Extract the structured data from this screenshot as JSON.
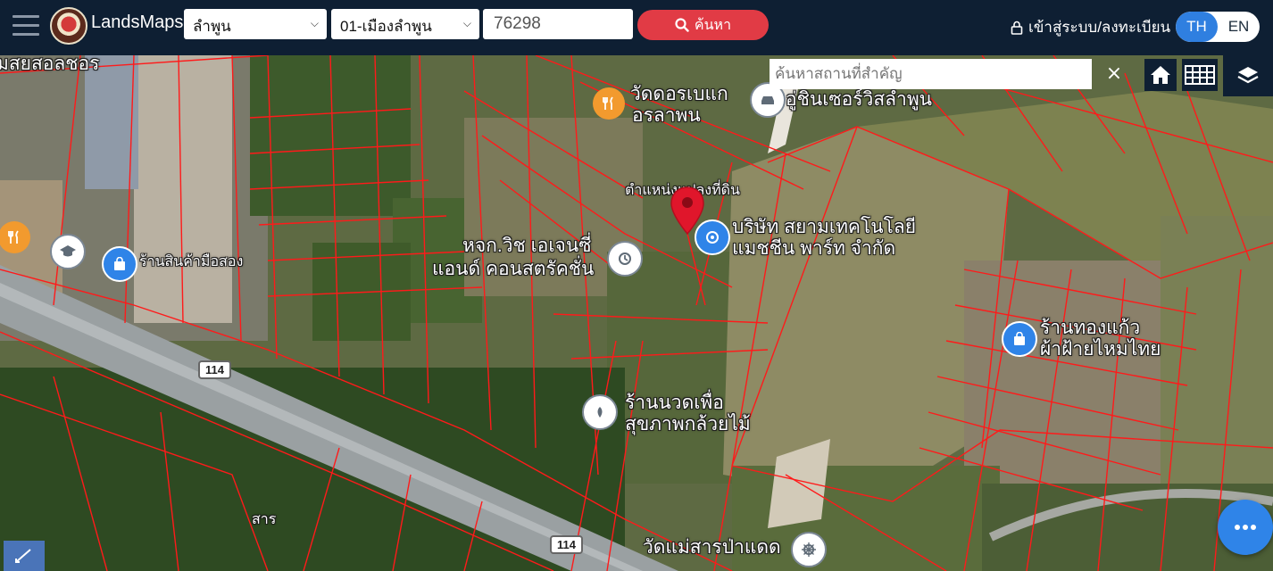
{
  "header": {
    "brand": "LandsMaps",
    "province_select": "ลำพูน",
    "district_select": "01-เมืองลำพูน",
    "parcel_number": "76298",
    "search_button": "ค้นหา",
    "login_label": "เข้าสู่ระบบ/ลงทะเบียน",
    "lang_th": "TH",
    "lang_en": "EN"
  },
  "map_tools": {
    "place_search_placeholder": "ค้นหาสถานที่สำคัญ",
    "clear_symbol": "×"
  },
  "map": {
    "parcel_pin_label": "ตำแหน่งแปลงที่ดิน",
    "labels": {
      "top_left_partial": "มสยสอลชอร",
      "temple_top": "วัดดอรเบแก",
      "temple_top_line2": "อรลาพน",
      "service": "อู่ชินเซอร์วิสลำพูน",
      "company_1": "บริษัท สยามเทคโนโลยี",
      "company_2": "แมชชีน พาร์ท จำกัด",
      "hlk_1": "หจก.วิช เอเจนซี่",
      "hlk_2": "แอนด์ คอนสตรัคชั่น",
      "shop_left": "ร้านสินค้ามือสอง",
      "shop_right_1": "ร้านทองแก้ว",
      "shop_right_2": "ผ้าฝ้ายไหมไทย",
      "massage_1": "ร้านนวดเพื่อ",
      "massage_2": "สุขภาพกล้วยไม้",
      "temple_bottom": "วัดแม่สารป่าแดด",
      "road_name": "สาร",
      "road_shield_1": "114",
      "road_shield_2": "114"
    },
    "colors": {
      "parcel_line": "#ff1a1a",
      "pin": "#e0162b",
      "poi_blue": "#2f84e8",
      "poi_orange": "#f29a2e"
    }
  }
}
